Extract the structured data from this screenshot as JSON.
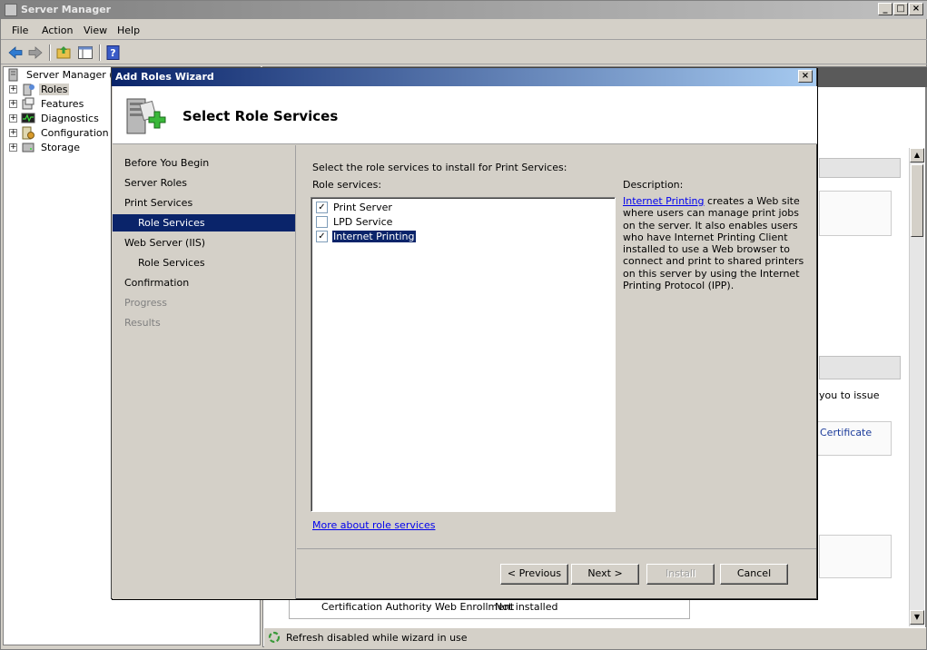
{
  "app": {
    "title": "Server Manager"
  },
  "window_controls": {
    "minimize": "_",
    "maximize": "□",
    "close": "×"
  },
  "menu": [
    "File",
    "Action",
    "View",
    "Help"
  ],
  "toolbar": [
    "back-icon",
    "forward-icon",
    "up-folder-icon",
    "show-hide-tree-icon",
    "help-icon"
  ],
  "tree": {
    "root_label": "Server Manager (D",
    "items": [
      {
        "label": "Roles",
        "icon": "roles-icon",
        "expander": "+",
        "selected": true
      },
      {
        "label": "Features",
        "icon": "features-icon",
        "expander": "+"
      },
      {
        "label": "Diagnostics",
        "icon": "diagnostics-icon",
        "expander": "+"
      },
      {
        "label": "Configuration",
        "icon": "configuration-icon",
        "expander": "+"
      },
      {
        "label": "Storage",
        "icon": "storage-icon",
        "expander": "+"
      }
    ]
  },
  "background": {
    "text_issue": "you to issue",
    "text_certificate": "Certificate",
    "table_row": {
      "name": "Certification Authority Web Enrollment",
      "status": "Not installed"
    },
    "status_text": "Refresh disabled while wizard in use"
  },
  "wizard": {
    "title": "Add Roles Wizard",
    "close": "×",
    "header_title": "Select Role Services",
    "nav": [
      {
        "label": "Before You Begin",
        "state": "normal",
        "indent": false
      },
      {
        "label": "Server Roles",
        "state": "normal",
        "indent": false
      },
      {
        "label": "Print Services",
        "state": "normal",
        "indent": false
      },
      {
        "label": "Role Services",
        "state": "selected",
        "indent": true
      },
      {
        "label": "Web Server (IIS)",
        "state": "normal",
        "indent": false
      },
      {
        "label": "Role Services",
        "state": "normal",
        "indent": true
      },
      {
        "label": "Confirmation",
        "state": "normal",
        "indent": false
      },
      {
        "label": "Progress",
        "state": "disabled",
        "indent": false
      },
      {
        "label": "Results",
        "state": "disabled",
        "indent": false
      }
    ],
    "instruction": "Select the role services to install for Print Services:",
    "role_services_label": "Role services:",
    "role_services": [
      {
        "label": "Print Server",
        "checked": true,
        "selected": false
      },
      {
        "label": "LPD Service",
        "checked": false,
        "selected": false
      },
      {
        "label": "Internet Printing",
        "checked": true,
        "selected": true
      }
    ],
    "check_glyph": "✓",
    "description_label": "Description:",
    "description_link": "Internet Printing",
    "description_text": " creates a Web site where users can manage print jobs on the server. It also enables users who have Internet Printing Client installed to use a Web browser to connect and print to shared printers on this server by using the Internet Printing Protocol (IPP).",
    "more_link": "More about role services",
    "buttons": {
      "previous": "< Previous",
      "next": "Next >",
      "install": "Install",
      "cancel": "Cancel"
    }
  },
  "colors": {
    "selection": "#0a246a",
    "wizard_title_start": "#0a246a",
    "wizard_title_end": "#a6caf0",
    "link": "#0000ee"
  }
}
